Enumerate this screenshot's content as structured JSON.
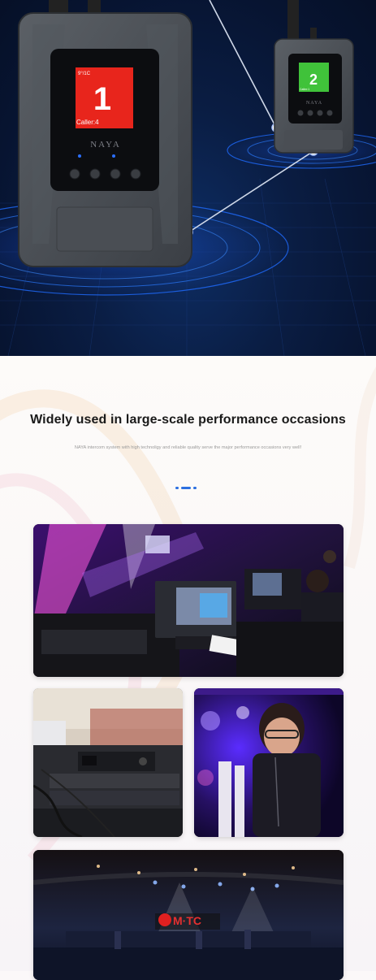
{
  "hero": {
    "device_large": {
      "status_text": "9°/1C",
      "channel_number": "1",
      "caller_label": "Caller:4",
      "brand": "NAYA"
    },
    "device_small": {
      "channel_number": "2",
      "caller_label": "Caller:1",
      "brand": "NAYA"
    },
    "colors": {
      "screen_red": "#e8251c",
      "screen_green": "#40c23a",
      "ring_blue": "#1f6bff"
    }
  },
  "section": {
    "headline": "Widely used in large-scale performance occasions",
    "subline": "NAYA intercom system with high technoligy and reliable quality serve the major performance occasions very well!"
  },
  "photos": {
    "concert_control_desk": {
      "description_icon": "photo-icon"
    },
    "rack_equipment": {
      "description_icon": "photo-icon"
    },
    "operator_headset": {
      "description_icon": "photo-icon"
    },
    "stage_concert": {
      "stage_sign": "M·TC"
    }
  }
}
